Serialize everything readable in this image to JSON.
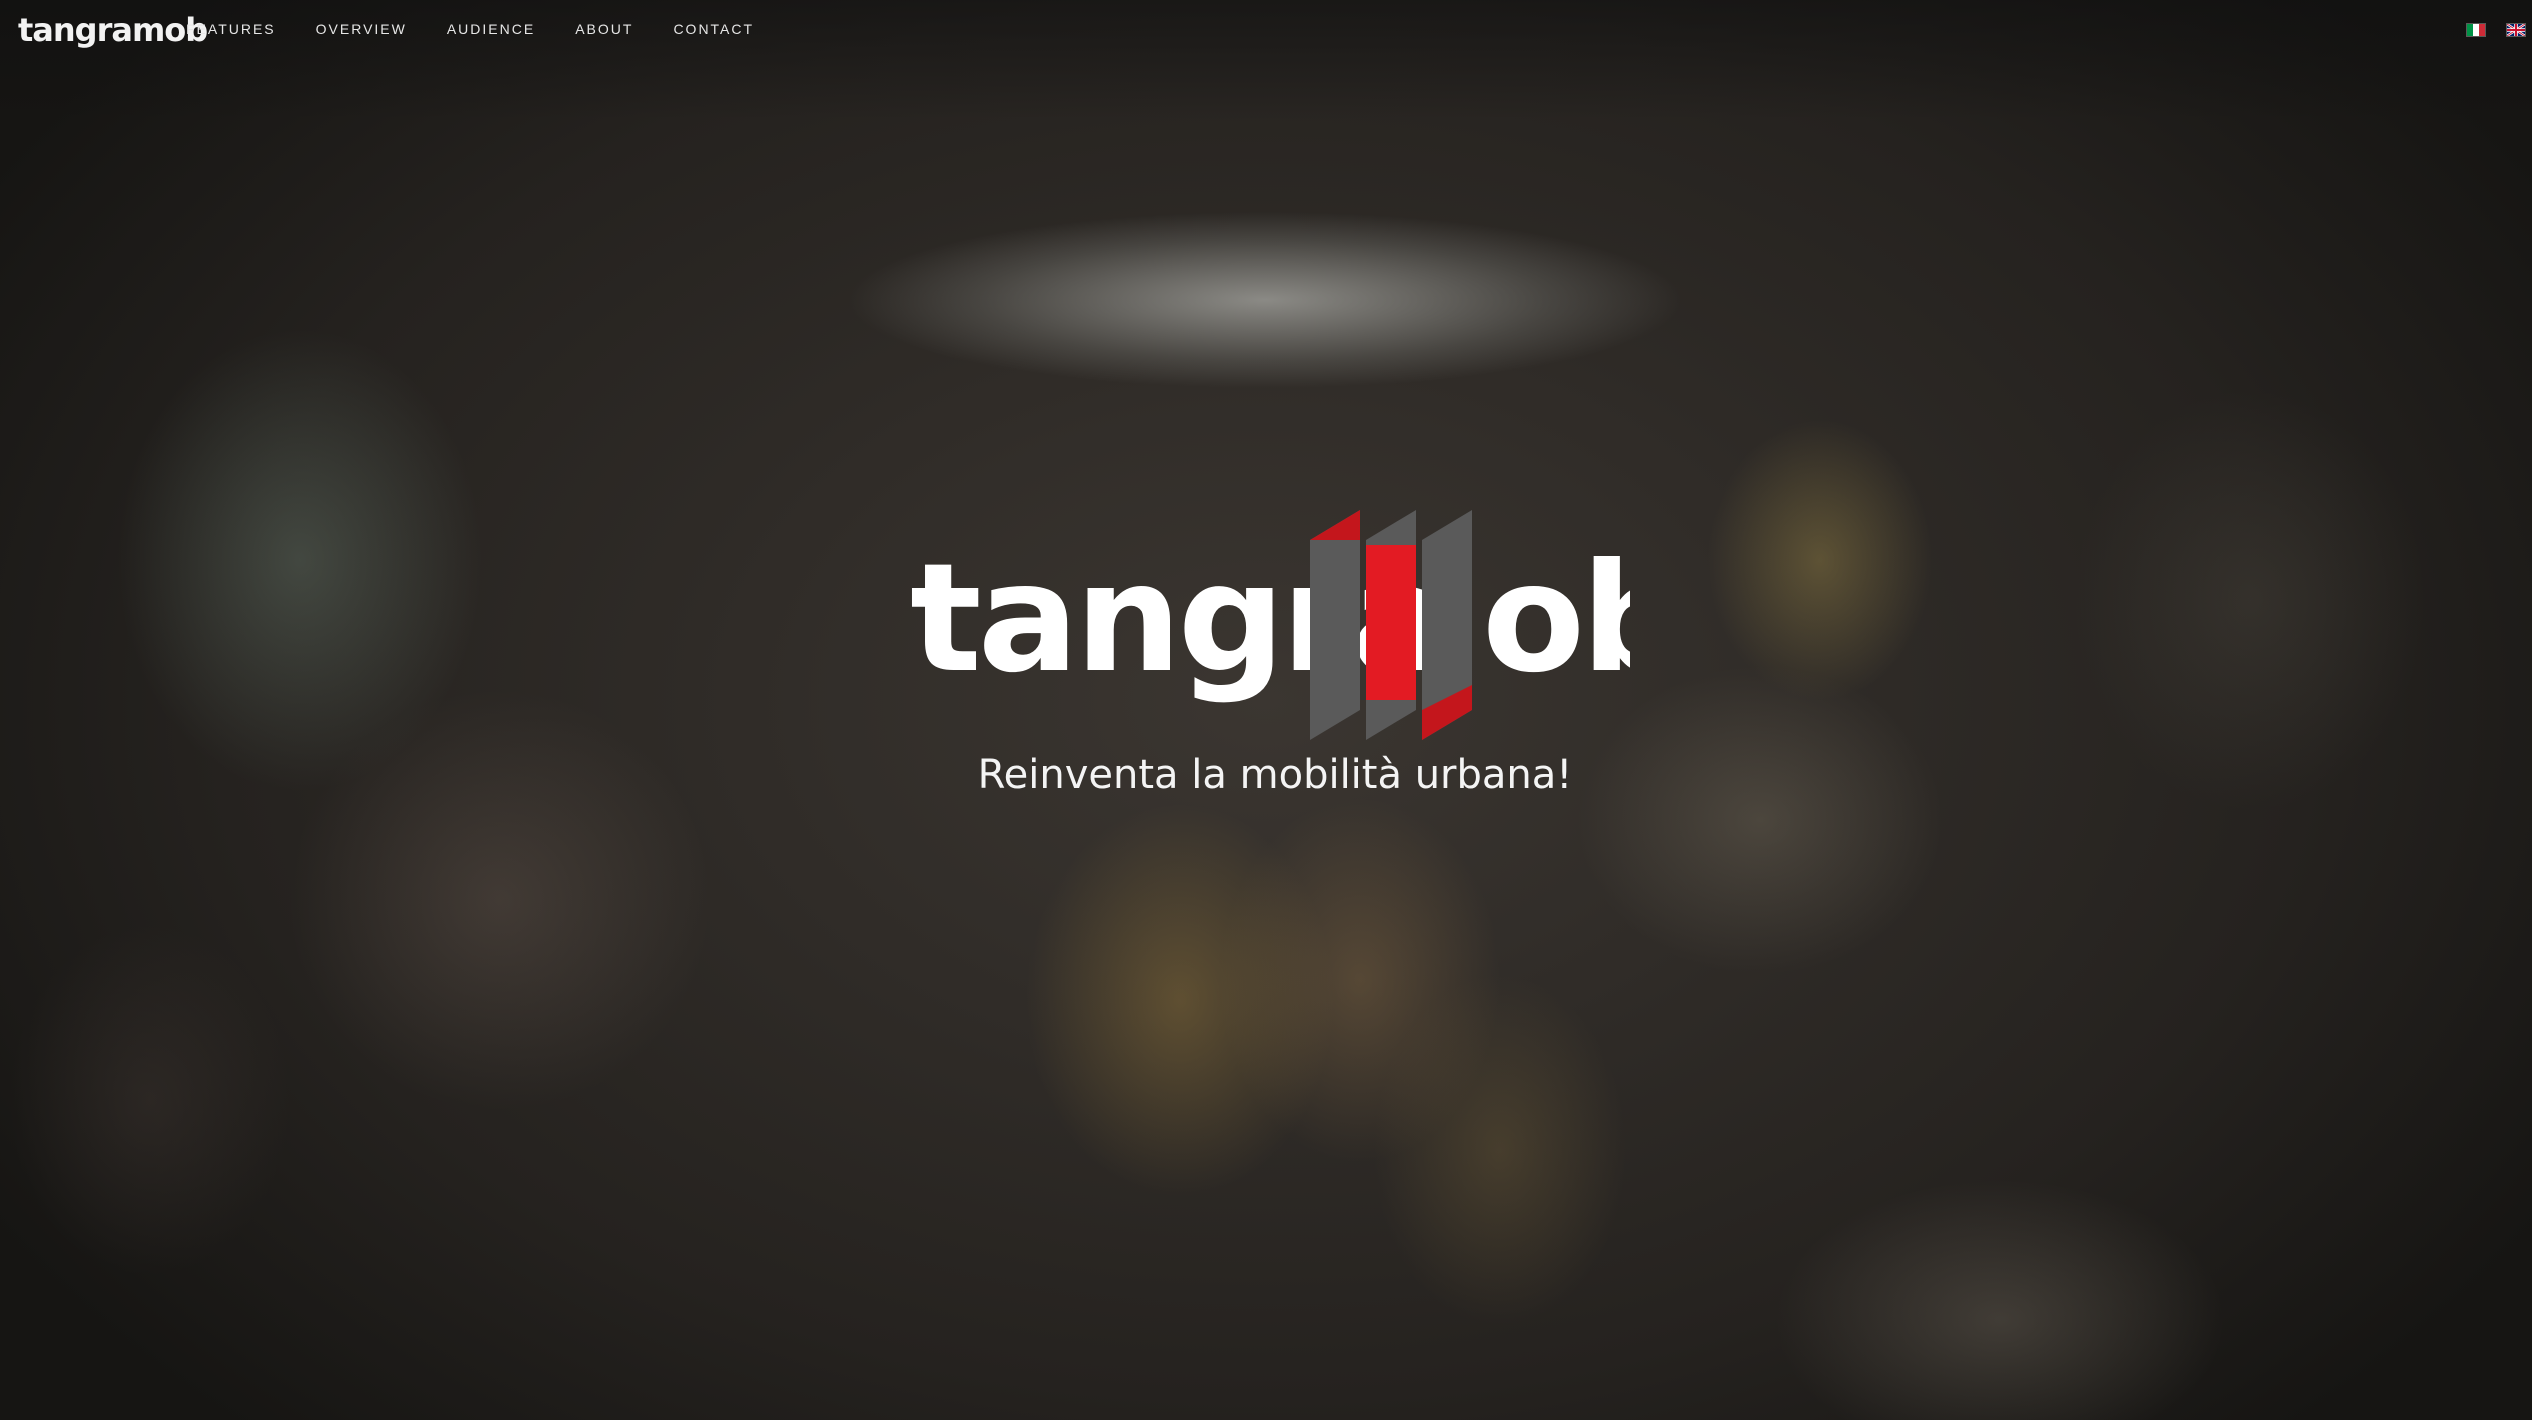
{
  "nav": {
    "brand": "tangramob",
    "links": [
      {
        "label": "FEATURES"
      },
      {
        "label": "OVERVIEW"
      },
      {
        "label": "AUDIENCE"
      },
      {
        "label": "ABOUT"
      },
      {
        "label": "CONTACT"
      }
    ],
    "languages": [
      {
        "icon": "italian-flag-icon"
      },
      {
        "icon": "uk-flag-icon"
      }
    ]
  },
  "hero": {
    "logo_left": "tangra",
    "logo_right": "ob",
    "tagline": "Reinventa la mobilità urbana!"
  },
  "colors": {
    "accent_red": "#e31b23",
    "logo_grey": "#5a5a5a",
    "text": "#ffffff"
  }
}
